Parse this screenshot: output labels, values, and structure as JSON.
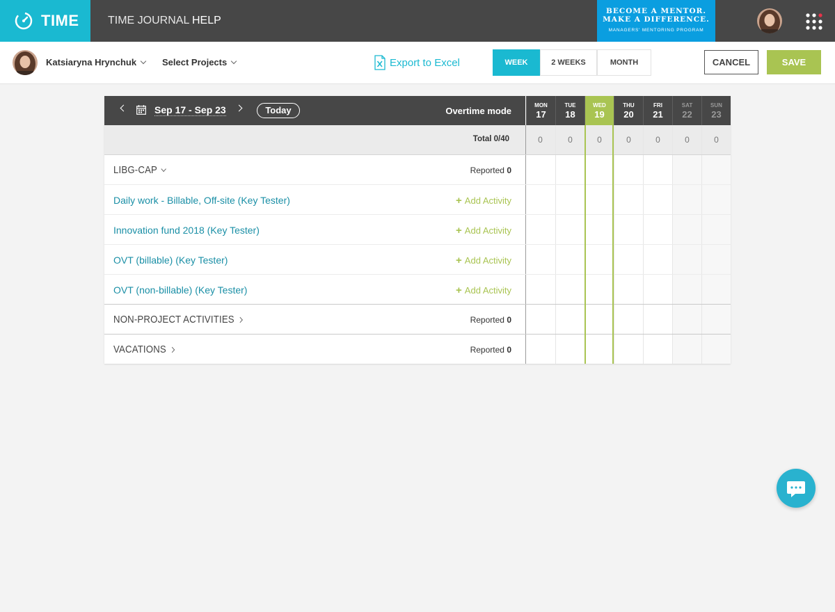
{
  "app": {
    "logo_text": "TIME"
  },
  "nav": {
    "time_journal": "TIME JOURNAL",
    "help": "HELP"
  },
  "banner": {
    "line1": "BECOME A MENTOR.",
    "line2": "MAKE A DIFFERENCE.",
    "line3": "MANAGERS' MENTORING PROGRAM"
  },
  "toolbar": {
    "user_name": "Katsiaryna Hrynchuk",
    "select_projects": "Select Projects",
    "export_label": "Export to Excel",
    "period_options": [
      "WEEK",
      "2 WEEKS",
      "MONTH"
    ],
    "period_selected": "WEEK",
    "cancel_label": "CANCEL",
    "save_label": "SAVE"
  },
  "timesheet": {
    "date_range": "Sep 17 - Sep 23",
    "today_label": "Today",
    "overtime_label": "Overtime mode",
    "total_label": "Total 0/40",
    "days": [
      {
        "name": "MON",
        "date": "17",
        "total": "0",
        "weekend": false,
        "today": false
      },
      {
        "name": "TUE",
        "date": "18",
        "total": "0",
        "weekend": false,
        "today": false
      },
      {
        "name": "WED",
        "date": "19",
        "total": "0",
        "weekend": false,
        "today": true
      },
      {
        "name": "THU",
        "date": "20",
        "total": "0",
        "weekend": false,
        "today": false
      },
      {
        "name": "FRI",
        "date": "21",
        "total": "0",
        "weekend": false,
        "today": false
      },
      {
        "name": "SAT",
        "date": "22",
        "total": "0",
        "weekend": true,
        "today": false
      },
      {
        "name": "SUN",
        "date": "23",
        "total": "0",
        "weekend": true,
        "today": false
      }
    ],
    "groups": [
      {
        "title": "LIBG-CAP",
        "expanded": true,
        "reported_label": "Reported",
        "reported_value": "0",
        "activities": [
          {
            "name": "Daily work - Billable, Off-site (Key Tester)",
            "add_label": "Add Activity"
          },
          {
            "name": "Innovation fund 2018 (Key Tester)",
            "add_label": "Add Activity"
          },
          {
            "name": "OVT (billable) (Key Tester)",
            "add_label": "Add Activity"
          },
          {
            "name": "OVT (non-billable) (Key Tester)",
            "add_label": "Add Activity"
          }
        ]
      },
      {
        "title": "NON-PROJECT ACTIVITIES",
        "expanded": false,
        "reported_label": "Reported",
        "reported_value": "0",
        "activities": []
      },
      {
        "title": "VACATIONS",
        "expanded": false,
        "reported_label": "Reported",
        "reported_value": "0",
        "activities": []
      }
    ]
  },
  "colors": {
    "accent": "#1ab9d1",
    "nav_bg": "#474747",
    "save": "#a9c452",
    "today": "#a9c452",
    "link": "#1a8fa6"
  },
  "icons": {
    "logo": "stopwatch-icon",
    "apps": "apps-grid-icon",
    "export": "excel-icon",
    "calendar": "calendar-icon",
    "chat": "chat-icon"
  }
}
